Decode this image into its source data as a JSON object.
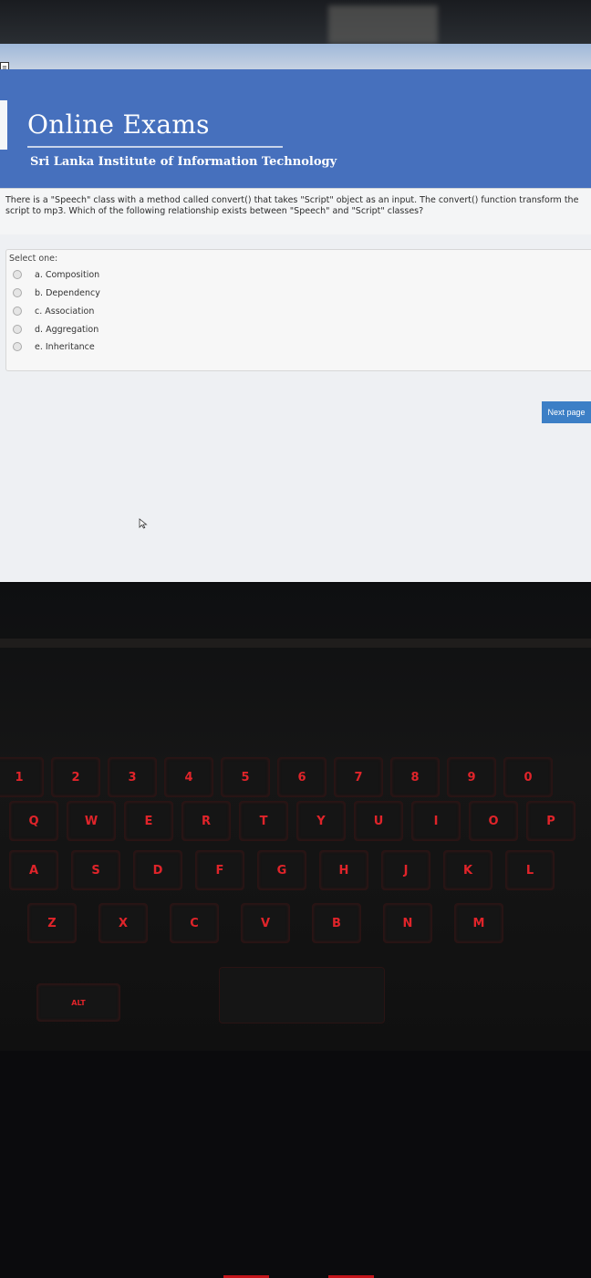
{
  "header": {
    "title": "Online Exams",
    "subtitle": "Sri Lanka Institute of Information Technology"
  },
  "question": {
    "text": "There is a \"Speech\" class with a method called convert() that takes \"Script\" object as an input. The convert() function transform the script to mp3. Which of the following relationship exists between \"Speech\" and \"Script\" classes?",
    "prompt": "Select one:",
    "options": [
      {
        "label": "a. Composition"
      },
      {
        "label": "b. Dependency"
      },
      {
        "label": "c. Association"
      },
      {
        "label": "d. Aggregation"
      },
      {
        "label": "e. Inheritance"
      }
    ]
  },
  "navigation": {
    "next_label": "Next page"
  },
  "keyboard": {
    "number_row": [
      "1",
      "2",
      "3",
      "4",
      "5",
      "6",
      "7",
      "8",
      "9",
      "0"
    ],
    "top_row": [
      "Q",
      "W",
      "E",
      "R",
      "T",
      "Y",
      "U",
      "I",
      "O",
      "P"
    ],
    "home_row": [
      "A",
      "S",
      "D",
      "F",
      "G",
      "H",
      "J",
      "K",
      "L"
    ],
    "bottom_row": [
      "Z",
      "X",
      "C",
      "V",
      "B",
      "N",
      "M"
    ],
    "alt_label": "ALT"
  },
  "colors": {
    "header_blue": "#4670bd",
    "button_blue": "#3c7fc6",
    "key_backlight": "#e0242a"
  }
}
